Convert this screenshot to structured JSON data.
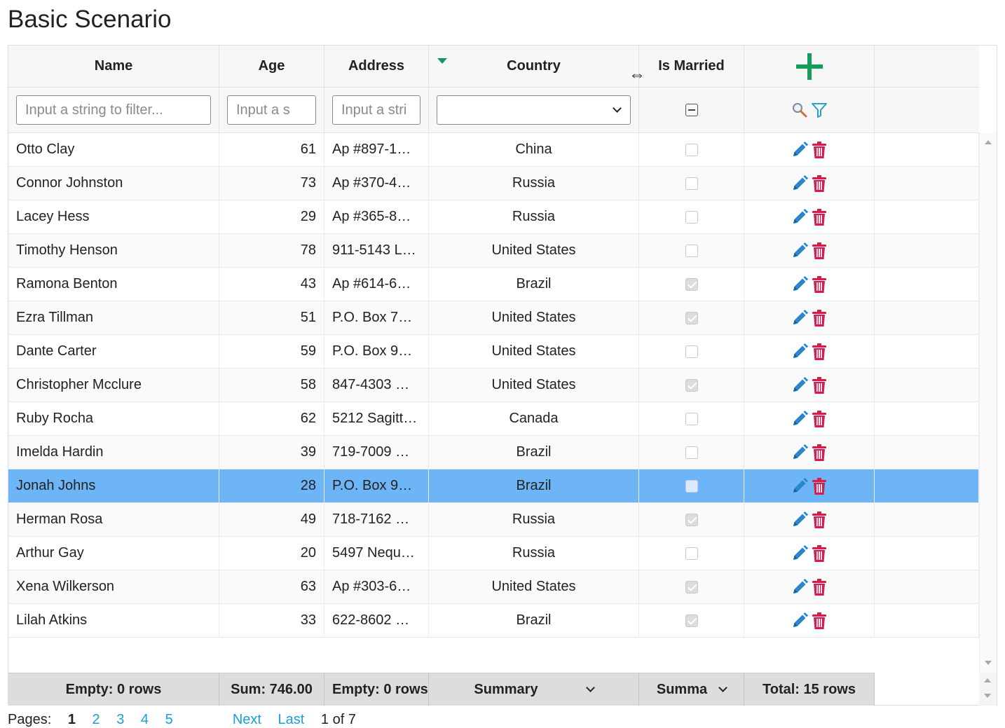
{
  "title": "Basic Scenario",
  "columns": {
    "name": "Name",
    "age": "Age",
    "address": "Address",
    "country": "Country",
    "married": "Is Married"
  },
  "filters": {
    "name_placeholder": "Input a string to filter...",
    "age_placeholder": "Input a s",
    "address_placeholder": "Input a stri",
    "country_value": ""
  },
  "rows": [
    {
      "name": "Otto Clay",
      "age": "61",
      "address": "Ap #897-1…",
      "country": "China",
      "married": false
    },
    {
      "name": "Connor Johnston",
      "age": "73",
      "address": "Ap #370-4…",
      "country": "Russia",
      "married": false
    },
    {
      "name": "Lacey Hess",
      "age": "29",
      "address": "Ap #365-8…",
      "country": "Russia",
      "married": false
    },
    {
      "name": "Timothy Henson",
      "age": "78",
      "address": "911-5143 L…",
      "country": "United States",
      "married": false
    },
    {
      "name": "Ramona Benton",
      "age": "43",
      "address": "Ap #614-6…",
      "country": "Brazil",
      "married": true
    },
    {
      "name": "Ezra Tillman",
      "age": "51",
      "address": "P.O. Box 7…",
      "country": "United States",
      "married": true
    },
    {
      "name": "Dante Carter",
      "age": "59",
      "address": "P.O. Box 9…",
      "country": "United States",
      "married": false
    },
    {
      "name": "Christopher Mcclure",
      "age": "58",
      "address": "847-4303 …",
      "country": "United States",
      "married": true
    },
    {
      "name": "Ruby Rocha",
      "age": "62",
      "address": "5212 Sagitt…",
      "country": "Canada",
      "married": false
    },
    {
      "name": "Imelda Hardin",
      "age": "39",
      "address": "719-7009 …",
      "country": "Brazil",
      "married": false
    },
    {
      "name": "Jonah Johns",
      "age": "28",
      "address": "P.O. Box 9…",
      "country": "Brazil",
      "married": false,
      "selected": true
    },
    {
      "name": "Herman Rosa",
      "age": "49",
      "address": "718-7162 …",
      "country": "Russia",
      "married": true
    },
    {
      "name": "Arthur Gay",
      "age": "20",
      "address": "5497 Nequ…",
      "country": "Russia",
      "married": false
    },
    {
      "name": "Xena Wilkerson",
      "age": "63",
      "address": "Ap #303-6…",
      "country": "United States",
      "married": true
    },
    {
      "name": "Lilah Atkins",
      "age": "33",
      "address": "622-8602 …",
      "country": "Brazil",
      "married": true
    }
  ],
  "footer": {
    "name": "Empty: 0 rows",
    "age": "Sum: 746.00",
    "address": "Empty: 0 rows",
    "country": "Summary",
    "married": "Summa",
    "actions": "Total: 15 rows"
  },
  "pager": {
    "label": "Pages:",
    "current": "1",
    "pages": [
      "2",
      "3",
      "4",
      "5"
    ],
    "next": "Next",
    "last": "Last",
    "info": "1 of 7"
  },
  "colors": {
    "accent_green": "#159c59",
    "sort_arrow": "#169272",
    "edit_blue": "#2a86c8",
    "delete_red": "#d81b4a",
    "selected_row": "#6eb5f7",
    "link": "#1a9ed8"
  },
  "icons": [
    "add-icon",
    "search-icon",
    "filter-icon",
    "edit-icon",
    "delete-icon",
    "resize-cursor-icon"
  ]
}
